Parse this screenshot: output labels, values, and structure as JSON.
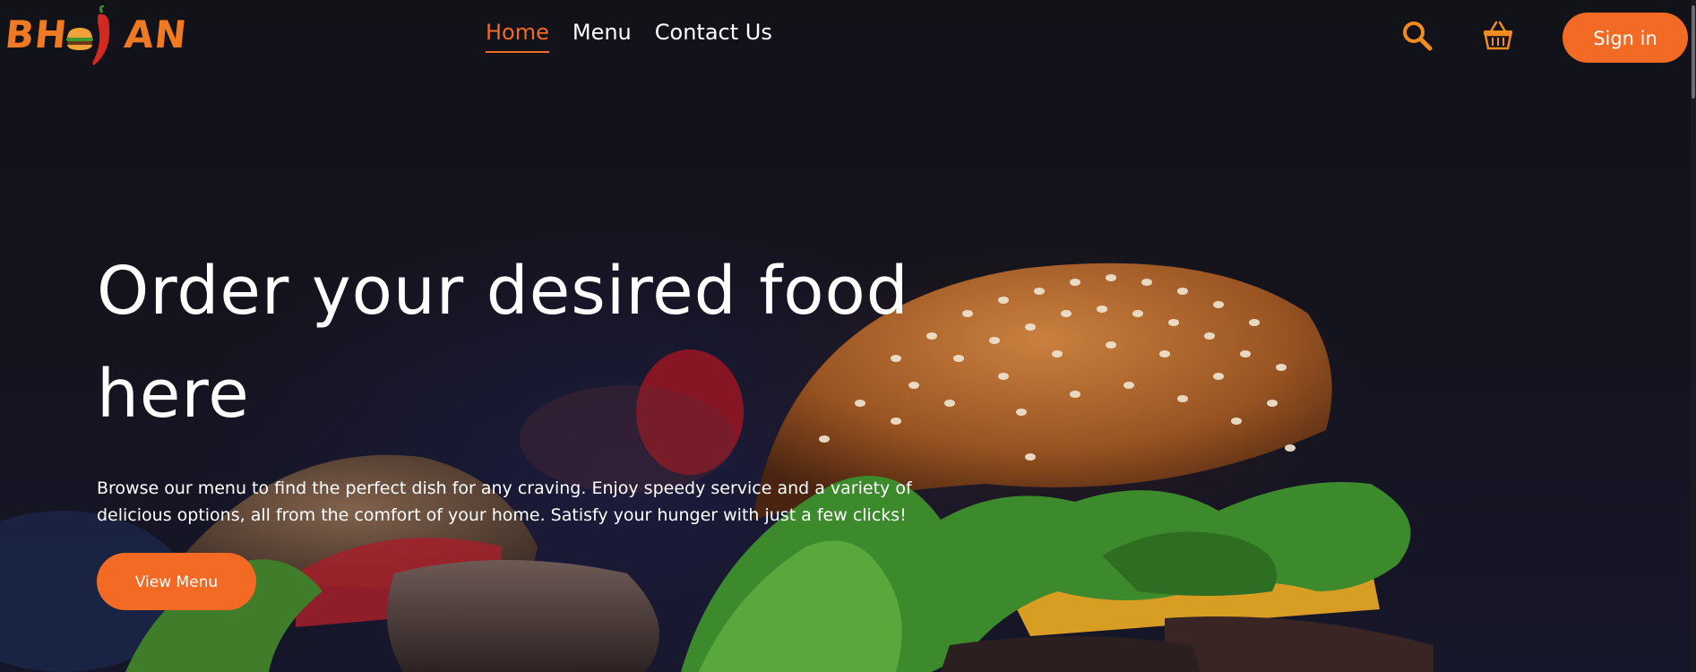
{
  "brand": {
    "logo_text_start": "BH",
    "logo_text_end": "AN",
    "primary_color": "#f26a23",
    "icon_color": "#f28c1e"
  },
  "nav": {
    "items": [
      {
        "label": "Home",
        "active": true
      },
      {
        "label": "Menu",
        "active": false
      },
      {
        "label": "Contact Us",
        "active": false
      }
    ]
  },
  "header": {
    "search_icon": "search-icon",
    "cart_icon": "basket-icon",
    "signin_label": "Sign in"
  },
  "hero": {
    "title": "Order your desired food here",
    "description": "Browse our menu to find the perfect dish for any craving. Enjoy speedy service and a variety of delicious options, all from the comfort of your home. Satisfy your hunger with just a few clicks!",
    "cta_label": "View Menu"
  }
}
